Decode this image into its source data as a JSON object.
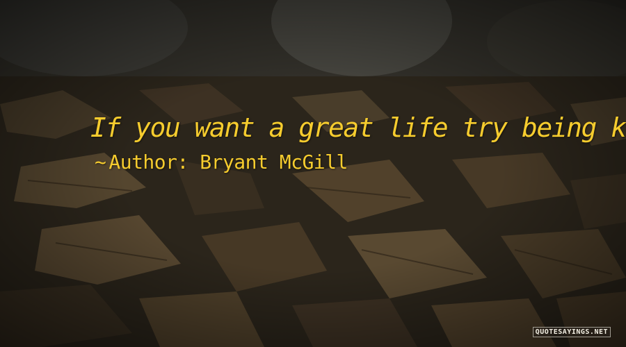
{
  "quote": {
    "text": "If you want a great life try being kind.",
    "author_prefix": "~",
    "author_label": "Author:",
    "author_name": "Bryant McGill"
  },
  "watermark": {
    "text": "quotesayings.net"
  },
  "colors": {
    "quote_text": "#f6cc2e",
    "watermark_text": "#f2eee2",
    "background": "#2a2419"
  }
}
